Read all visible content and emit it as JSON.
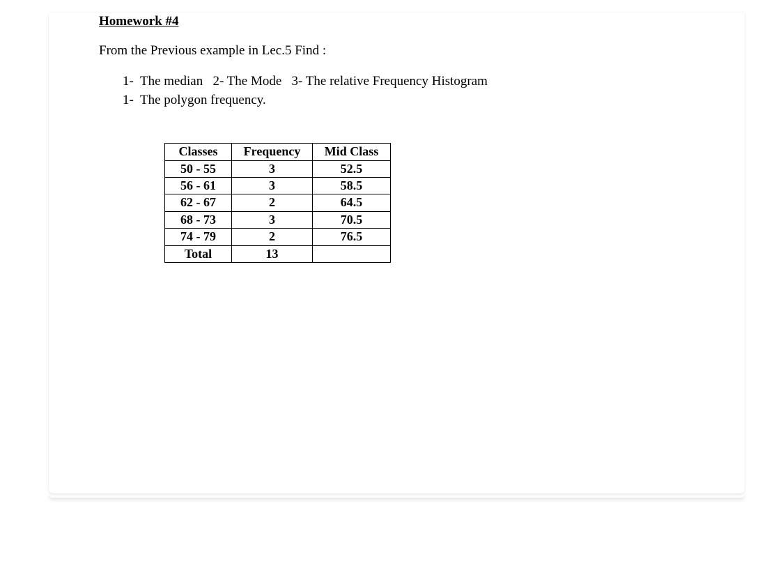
{
  "title": "Homework #4",
  "intro": "From the Previous example in Lec.5 Find :",
  "questions": {
    "line1": "1-  The median   2- The Mode   3- The relative Frequency Histogram",
    "line2": "1-  The polygon frequency."
  },
  "table": {
    "headers": [
      "Classes",
      "Frequency",
      "Mid Class"
    ],
    "rows": [
      {
        "class": "50 - 55",
        "freq": "3",
        "mid": "52.5"
      },
      {
        "class": "56 - 61",
        "freq": "3",
        "mid": "58.5"
      },
      {
        "class": "62 - 67",
        "freq": "2",
        "mid": "64.5"
      },
      {
        "class": "68 - 73",
        "freq": "3",
        "mid": "70.5"
      },
      {
        "class": "74 - 79",
        "freq": "2",
        "mid": "76.5"
      }
    ],
    "total_label": "Total",
    "total_freq": "13"
  }
}
